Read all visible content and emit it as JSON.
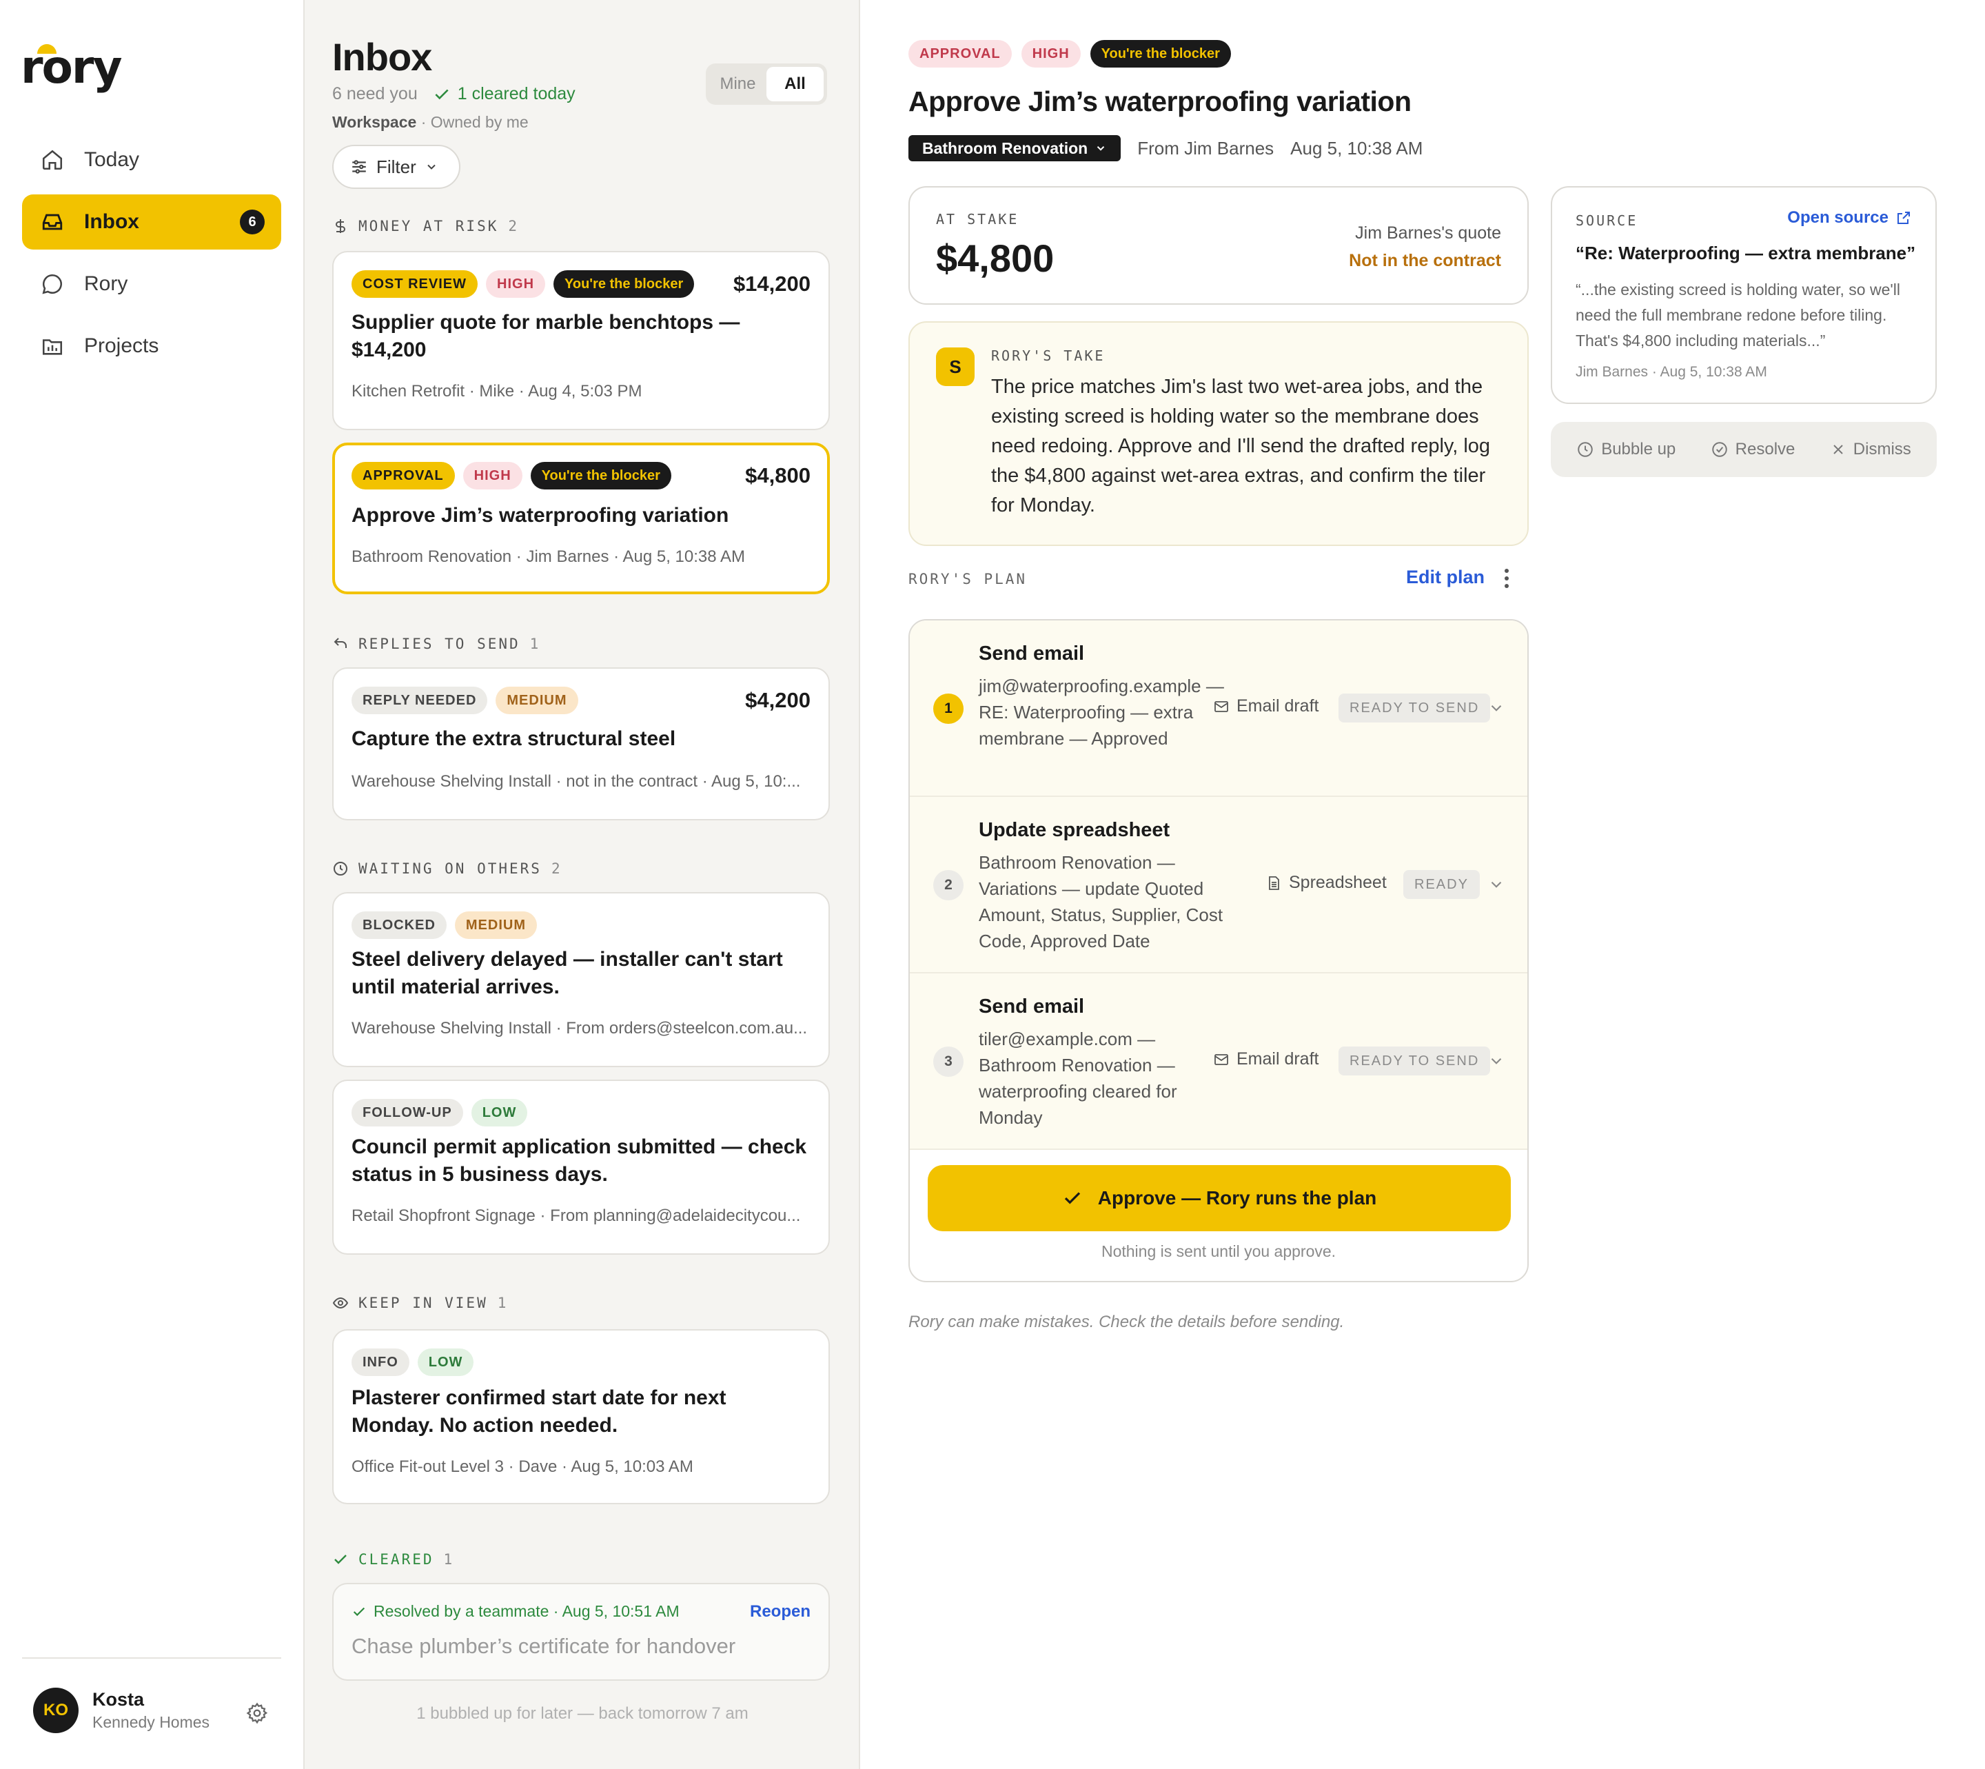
{
  "app": {
    "logo_text": "rory",
    "brand_color": "#f2c200"
  },
  "sidebar": {
    "items": [
      {
        "label": "Today",
        "icon": "home-icon"
      },
      {
        "label": "Inbox",
        "icon": "inbox-icon",
        "badge": "6"
      },
      {
        "label": "Rory",
        "icon": "chat-bubble-icon"
      },
      {
        "label": "Projects",
        "icon": "projects-icon"
      }
    ],
    "user": {
      "initials": "KO",
      "name": "Kosta",
      "org": "Kennedy Homes"
    }
  },
  "inbox": {
    "title": "Inbox",
    "need_you": "6 need you",
    "cleared_today": "1 cleared today",
    "workspace": "Workspace",
    "owned": "Owned by me",
    "toggle": {
      "mine": "Mine",
      "all": "All"
    },
    "filter": "Filter",
    "sections": {
      "money": {
        "label": "MONEY AT RISK",
        "count": "2"
      },
      "replies": {
        "label": "REPLIES TO SEND",
        "count": "1"
      },
      "waiting": {
        "label": "WAITING ON OTHERS",
        "count": "2"
      },
      "keep": {
        "label": "KEEP IN VIEW",
        "count": "1"
      },
      "cleared": {
        "label": "CLEARED",
        "count": "1"
      }
    },
    "cards": [
      {
        "badges": [
          "COST REVIEW",
          "HIGH",
          "You're the blocker"
        ],
        "amount": "$14,200",
        "title": "Supplier quote for marble benchtops — $14,200",
        "meta": "Kitchen Retrofit · Mike · Aug 4, 5:03 PM"
      },
      {
        "badges": [
          "APPROVAL",
          "HIGH",
          "You're the blocker"
        ],
        "amount": "$4,800",
        "title": "Approve Jim’s waterproofing variation",
        "meta": "Bathroom Renovation · Jim Barnes · Aug 5, 10:38 AM"
      },
      {
        "badges": [
          "REPLY NEEDED",
          "MEDIUM"
        ],
        "amount": "$4,200",
        "title": "Capture the extra structural steel",
        "meta": "Warehouse Shelving Install · not in the contract · Aug 5, 10:..."
      },
      {
        "badges": [
          "BLOCKED",
          "MEDIUM"
        ],
        "title": "Steel delivery delayed — installer can't start until material arrives.",
        "meta": "Warehouse Shelving Install · From orders@steelcon.com.au..."
      },
      {
        "badges": [
          "FOLLOW-UP",
          "LOW"
        ],
        "title": "Council permit application submitted — check status in 5 business days.",
        "meta": "Retail Shopfront Signage · From planning@adelaidecitycou..."
      },
      {
        "badges": [
          "INFO",
          "LOW"
        ],
        "title": "Plasterer confirmed start date for next Monday. No action needed.",
        "meta": "Office Fit-out Level 3 · Dave · Aug 5, 10:03 AM"
      }
    ],
    "cleared_card": {
      "line": "Resolved by a teammate · Aug 5, 10:51 AM",
      "reopen": "Reopen",
      "title": "Chase plumber’s certificate for handover"
    },
    "bubbled": "1 bubbled up for later — back tomorrow 7 am"
  },
  "detail": {
    "badges": [
      "APPROVAL",
      "HIGH",
      "You're the blocker"
    ],
    "title": "Approve Jim’s waterproofing variation",
    "project": "Bathroom Renovation",
    "from": "From Jim Barnes",
    "date": "Aug 5, 10:38 AM",
    "stake": {
      "label": "AT STAKE",
      "amount": "$4,800",
      "quote": "Jim Barnes's quote",
      "warning": "Not in the contract"
    },
    "take": {
      "avatar": "S",
      "label": "RORY'S TAKE",
      "text": "The price matches Jim's last two wet-area jobs, and the existing screed is holding water so the membrane does need redoing. Approve and I'll send the drafted reply, log the $4,800 against wet-area extras, and confirm the tiler for Monday."
    },
    "plan": {
      "label": "RORY'S PLAN",
      "edit": "Edit plan",
      "steps": [
        {
          "num": "1",
          "title": "Send email",
          "desc": "jim@waterproofing.example — RE: Waterproofing — extra membrane — Approved",
          "kind": "Email draft",
          "status": "READY TO SEND"
        },
        {
          "num": "2",
          "title": "Update spreadsheet",
          "desc": "Bathroom Renovation — Variations — update Quoted Amount, Status, Supplier, Cost Code, Approved Date",
          "kind": "Spreadsheet",
          "status": "READY"
        },
        {
          "num": "3",
          "title": "Send email",
          "desc": "tiler@example.com — Bathroom Renovation — waterproofing cleared for Monday",
          "kind": "Email draft",
          "status": "READY TO SEND"
        }
      ],
      "approve": "Approve — Rory runs the plan",
      "note": "Nothing is sent until you approve."
    },
    "disclaimer": "Rory can make mistakes. Check the details before sending.",
    "source": {
      "label": "SOURCE",
      "open": "Open source",
      "title": "“Re: Waterproofing — extra membrane”",
      "quote": "“...the existing screed is holding water, so we'll need the full membrane redone before tiling. That's $4,800 including materials...”",
      "meta": "Jim Barnes · Aug 5, 10:38 AM"
    },
    "actions": {
      "bubble": "Bubble up",
      "resolve": "Resolve",
      "dismiss": "Dismiss"
    }
  }
}
